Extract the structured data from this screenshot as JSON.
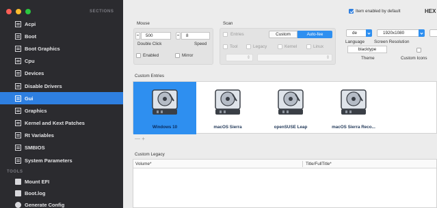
{
  "sidebar": {
    "sections_header": "SECTIONS",
    "tools_header": "TOOLS",
    "items": [
      {
        "label": "Acpi"
      },
      {
        "label": "Boot"
      },
      {
        "label": "Boot Graphics"
      },
      {
        "label": "Cpu"
      },
      {
        "label": "Devices"
      },
      {
        "label": "Disable Drivers"
      },
      {
        "label": "Gui",
        "selected": true
      },
      {
        "label": "Graphics"
      },
      {
        "label": "Kernel and Kext Patches"
      },
      {
        "label": "Rt Variables"
      },
      {
        "label": "SMBIOS"
      },
      {
        "label": "System Parameters"
      }
    ],
    "tools": [
      {
        "label": "Mount EFI"
      },
      {
        "label": "Boot.log"
      },
      {
        "label": "Generate Config"
      }
    ],
    "colors": {
      "background": "#2b2b2f",
      "selected": "#2e7fe0"
    }
  },
  "main": {
    "item_enabled_label": "Item enabled by default",
    "item_enabled_checked": true,
    "hex_label": "HEX",
    "mouse": {
      "title": "Mouse",
      "double_click_value": "500",
      "double_click_label": "Double Click",
      "speed_value": "8",
      "speed_label": "Speed",
      "enabled_label": "Enabled",
      "mirror_label": "Mirror"
    },
    "scan": {
      "title": "Scan",
      "entries_label": "Entries",
      "custom_label": "Custom",
      "autofee_label": "Auto-fee",
      "tool_label": "Tool",
      "legacy_label": "Legacy",
      "kernel_label": "Kernel",
      "linux_label": "Linux"
    },
    "language": {
      "value": "de",
      "label": "Language"
    },
    "resolution": {
      "value": "1920x1080",
      "label": "Screen Resolution"
    },
    "theme": {
      "value": "blacktype",
      "label": "Theme"
    },
    "custom_icons_label": "Custom Icons",
    "custom_entries": {
      "title": "Custom Entries",
      "items": [
        {
          "label": "Windows 10",
          "selected": true
        },
        {
          "label": "macOS Sierra"
        },
        {
          "label": "openSUSE Leap"
        },
        {
          "label": "macOS Sierra Reco..."
        }
      ],
      "add_remove": "— +"
    },
    "custom_legacy": {
      "title": "Custom Legacy",
      "columns": [
        "Volume*",
        "Title/FullTitle*"
      ]
    },
    "accent_color": "#2e8ff0"
  }
}
